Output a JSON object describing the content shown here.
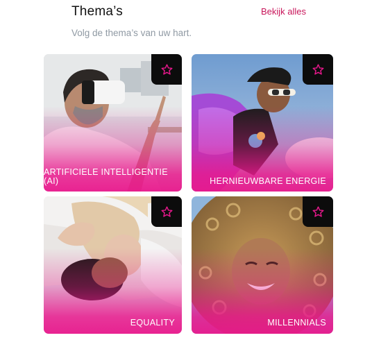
{
  "header": {
    "title": "Thema’s",
    "see_all_label": "Bekijk alles",
    "subtitle": "Volg de thema’s van uw hart."
  },
  "accent_color": "#c8155a",
  "overlay_color": "#e8188c",
  "cards": [
    {
      "label": "Artificiele intelligentie (AI)",
      "icon": "star-outline-icon"
    },
    {
      "label": "Hernieuwbare energie",
      "icon": "star-outline-icon"
    },
    {
      "label": "Equality",
      "icon": "star-outline-icon"
    },
    {
      "label": "Millennials",
      "icon": "star-outline-icon"
    }
  ]
}
